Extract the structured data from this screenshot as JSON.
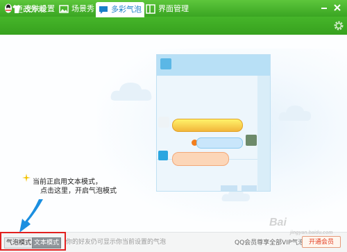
{
  "window": {
    "title": "更改外观"
  },
  "tabs": [
    {
      "label": "皮肤设置",
      "icon": "shirt-icon"
    },
    {
      "label": "场景秀",
      "icon": "picture-icon"
    },
    {
      "label": "多彩气泡",
      "icon": "chat-bubble-icon",
      "active": true
    },
    {
      "label": "界面管理",
      "icon": "layout-icon"
    }
  ],
  "hint": {
    "line1": "当前正启用文本模式，",
    "line2": "点击这里，开启气泡模式"
  },
  "bottom": {
    "bubble_mode_label": "气泡模式",
    "text_mode_label": "文本模式",
    "description": "你的好友仍可显示你当前设置的气泡",
    "vip_text": "QQ会员尊享全部VIP气泡",
    "vip_button": "开通会员"
  },
  "watermark": {
    "brand": "Bai",
    "sub": "jingyan.baidu.com"
  },
  "colors": {
    "titlebar": "#3aa522",
    "accent": "#1a7fc8",
    "highlight_border": "#e2201f"
  }
}
